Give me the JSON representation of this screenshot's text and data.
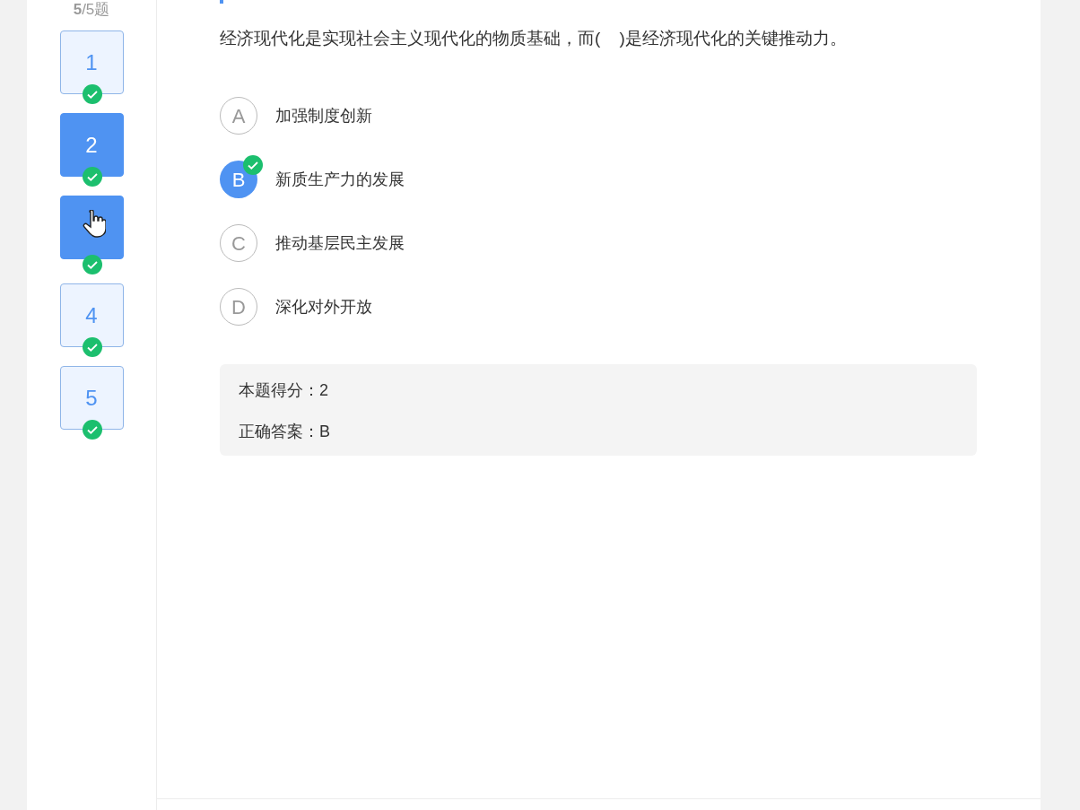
{
  "progress": "**5**/5题",
  "questions": [
    {
      "number": "1",
      "selected": false,
      "answered": true,
      "pointer": false
    },
    {
      "number": "2",
      "selected": true,
      "answered": true,
      "pointer": false
    },
    {
      "selected": true,
      "answered": true,
      "pointer": true
    },
    {
      "number": "4",
      "selected": false,
      "answered": true,
      "pointer": false
    },
    {
      "number": "5",
      "selected": false,
      "answered": true,
      "pointer": false
    }
  ],
  "question": {
    "text": "经济现代化是实现社会主义现代化的物质基础，而(    )是经济现代化的关键推动力。",
    "options": [
      {
        "letter": "A",
        "text": "加强制度创新",
        "selected": false,
        "correct": false
      },
      {
        "letter": "B",
        "text": "新质生产力的发展",
        "selected": true,
        "correct": true
      },
      {
        "letter": "C",
        "text": "推动基层民主发展",
        "selected": false,
        "correct": false
      },
      {
        "letter": "D",
        "text": "深化对外开放",
        "selected": false,
        "correct": false
      }
    ]
  },
  "result": {
    "score": "本题得分：2",
    "answer": "正确答案：B"
  }
}
